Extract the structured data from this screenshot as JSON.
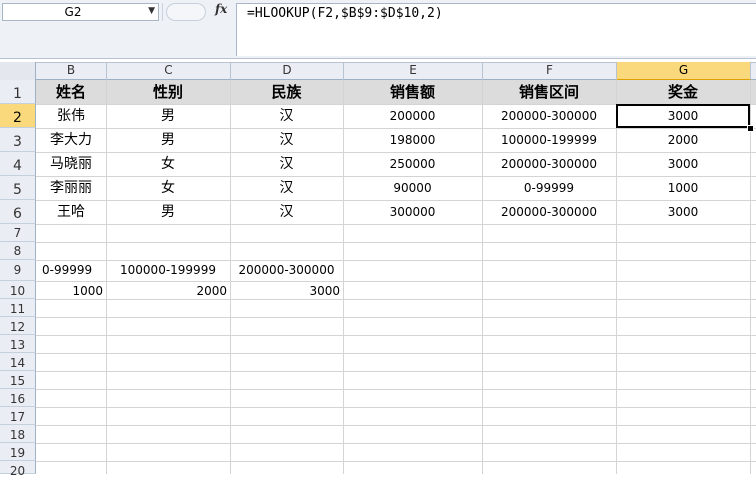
{
  "formula_bar": {
    "name_box": "G2",
    "fx_label": "fx",
    "formula": "=HLOOKUP(F2,$B$9:$D$10,2)"
  },
  "columns": [
    "B",
    "C",
    "D",
    "E",
    "F",
    "G"
  ],
  "active_column": "G",
  "rows": [
    "1",
    "2",
    "3",
    "4",
    "5",
    "6",
    "7",
    "8",
    "9",
    "10",
    "11",
    "12",
    "13",
    "14",
    "15",
    "16",
    "17",
    "18",
    "19",
    "20"
  ],
  "active_row": "2",
  "header_row": [
    "姓名",
    "性别",
    "民族",
    "销售额",
    "销售区间",
    "奖金"
  ],
  "data_rows": [
    [
      "张伟",
      "男",
      "汉",
      "200000",
      "200000-300000",
      "3000"
    ],
    [
      "李大力",
      "男",
      "汉",
      "198000",
      "100000-199999",
      "2000"
    ],
    [
      "马晓丽",
      "女",
      "汉",
      "250000",
      "200000-300000",
      "3000"
    ],
    [
      "李丽丽",
      "女",
      "汉",
      "90000",
      "0-99999",
      "1000"
    ],
    [
      "王哈",
      "男",
      "汉",
      "300000",
      "200000-300000",
      "3000"
    ]
  ],
  "lookup_table": {
    "ranges": [
      "0-99999",
      "100000-199999",
      "200000-300000"
    ],
    "bonuses": [
      "1000",
      "2000",
      "3000"
    ]
  },
  "colors": {
    "active_header": "#f9d97b",
    "header_fill": "#dcdcdc",
    "grid_line": "#d4d4d4"
  }
}
